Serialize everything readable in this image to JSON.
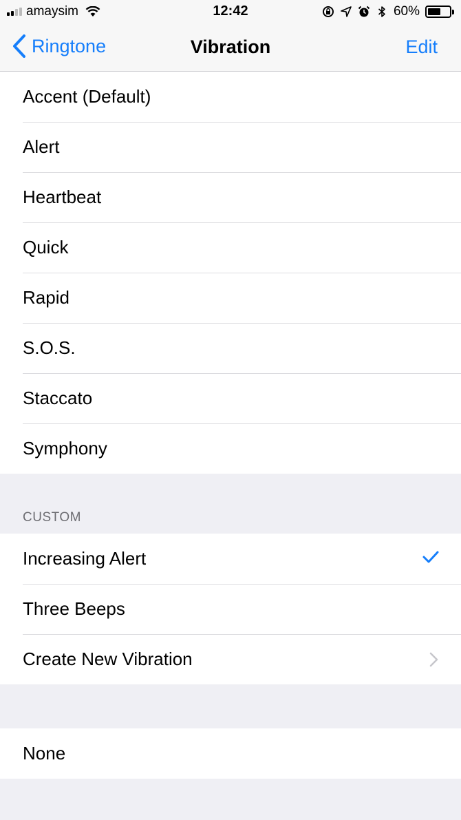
{
  "status_bar": {
    "carrier": "amaysim",
    "time": "12:42",
    "battery_percent_label": "60%",
    "battery_level": 0.6,
    "icons": [
      "signal-icon",
      "wifi-icon",
      "rotation-lock-icon",
      "location-icon",
      "alarm-icon",
      "bluetooth-icon",
      "battery-icon"
    ]
  },
  "nav": {
    "back_label": "Ringtone",
    "title": "Vibration",
    "edit_label": "Edit"
  },
  "standard": {
    "items": [
      {
        "label": "Accent (Default)"
      },
      {
        "label": "Alert"
      },
      {
        "label": "Heartbeat"
      },
      {
        "label": "Quick"
      },
      {
        "label": "Rapid"
      },
      {
        "label": "S.O.S."
      },
      {
        "label": "Staccato"
      },
      {
        "label": "Symphony"
      }
    ]
  },
  "custom": {
    "header": "CUSTOM",
    "items": [
      {
        "label": "Increasing Alert",
        "selected": true
      },
      {
        "label": "Three Beeps"
      },
      {
        "label": "Create New Vibration",
        "accessory": "chevron"
      }
    ]
  },
  "none_group": {
    "items": [
      {
        "label": "None"
      }
    ]
  },
  "colors": {
    "accent": "#157efb",
    "group_background": "#efeff4",
    "cell_background": "#ffffff",
    "separator": "#dcdce0",
    "section_header": "#6d6d72"
  }
}
